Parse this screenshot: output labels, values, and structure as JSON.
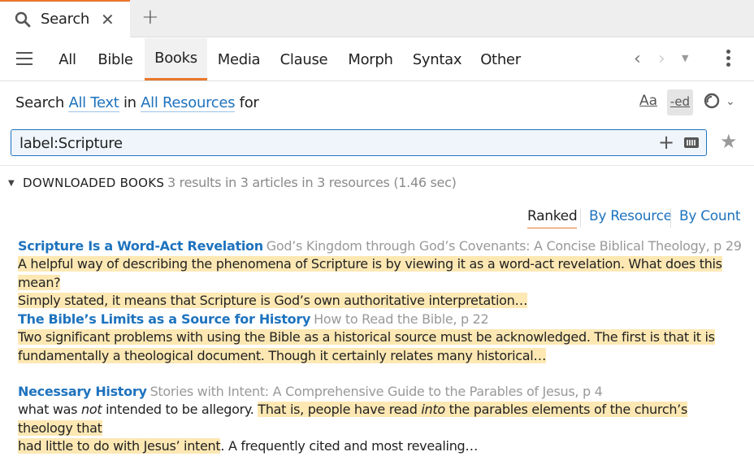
{
  "tab": {
    "title": "Search"
  },
  "nav": {
    "tabs": [
      {
        "label": "All"
      },
      {
        "label": "Bible"
      },
      {
        "label": "Books"
      },
      {
        "label": "Media"
      },
      {
        "label": "Clause"
      },
      {
        "label": "Morph"
      },
      {
        "label": "Syntax"
      },
      {
        "label": "Other"
      }
    ],
    "active": "Books"
  },
  "query": {
    "prefix": "Search",
    "scope": "All Text",
    "in": "in",
    "resources": "All Resources",
    "for": "for",
    "tools": {
      "case": "Aa",
      "ed": "-ed"
    }
  },
  "search": {
    "value": "label:Scripture"
  },
  "section": {
    "title": "DOWNLOADED BOOKS",
    "summary": "3 results in 3 articles in 3 resources (1.46 sec)"
  },
  "sort": {
    "ranked": "Ranked",
    "by_resource": "By Resource",
    "by_count": "By Count"
  },
  "results": [
    {
      "title": "Scripture Is a Word-Act Revelation",
      "source": "God’s Kingdom through God’s Covenants: A Concise Biblical Theology, p 29",
      "line1": "A helpful way of describing the phenomena of Scripture is by viewing it as a word-act revelation. What does this mean?",
      "line2": "Simply stated, it means that Scripture is God’s own authoritative interpretation…"
    },
    {
      "title": "The Bible’s Limits as a Source for History",
      "source": "How to Read the Bible, p 22",
      "line1": "Two significant problems with using the Bible as a historical source must be acknowledged. The first is that it is",
      "line2": "fundamentally a theological document. Though it certainly relates many historical…"
    },
    {
      "title": "Necessary History",
      "source": "Stories with Intent: A Comprehensive Guide to the Parables of Jesus, p 4",
      "l1_plain_a": "what was ",
      "l1_em_a": "not",
      "l1_plain_b": " intended to be allegory. ",
      "l1_hl_a": "That is, people have read ",
      "l1_em_b": "into",
      "l1_hl_b": " the parables elements of the church’s theology that",
      "l2_hl": "had little to do with Jesus’ intent",
      "l2_plain": ". A frequently cited and most revealing…"
    }
  ],
  "colors": {
    "accent": "#e8772e",
    "link": "#1e73be",
    "highlight": "#fde8b3"
  }
}
